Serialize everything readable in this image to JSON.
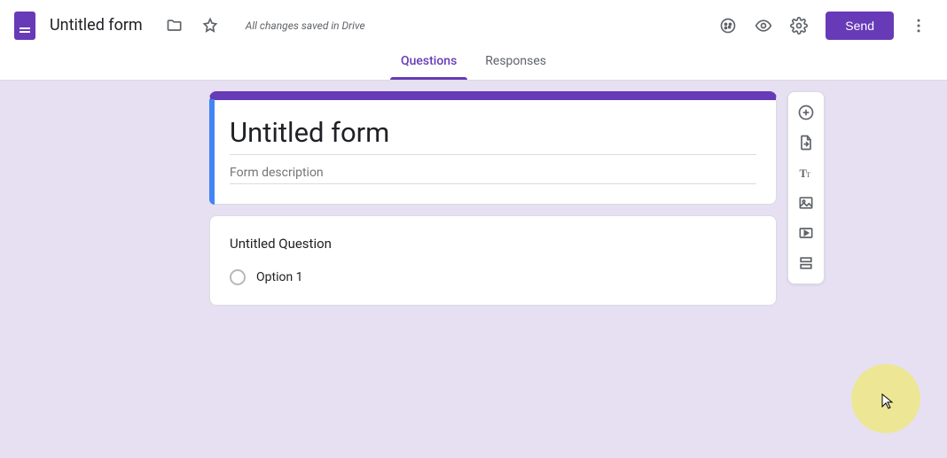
{
  "header": {
    "formName": "Untitled form",
    "saveStatus": "All changes saved in Drive",
    "sendLabel": "Send"
  },
  "tabs": {
    "questions": "Questions",
    "responses": "Responses"
  },
  "form": {
    "title": "Untitled form",
    "descriptionPlaceholder": "Form description"
  },
  "question": {
    "title": "Untitled Question",
    "option1": "Option 1"
  },
  "sideToolbar": {
    "add": "Add question",
    "import": "Import questions",
    "title": "Add title and description",
    "image": "Add image",
    "video": "Add video",
    "section": "Add section"
  }
}
